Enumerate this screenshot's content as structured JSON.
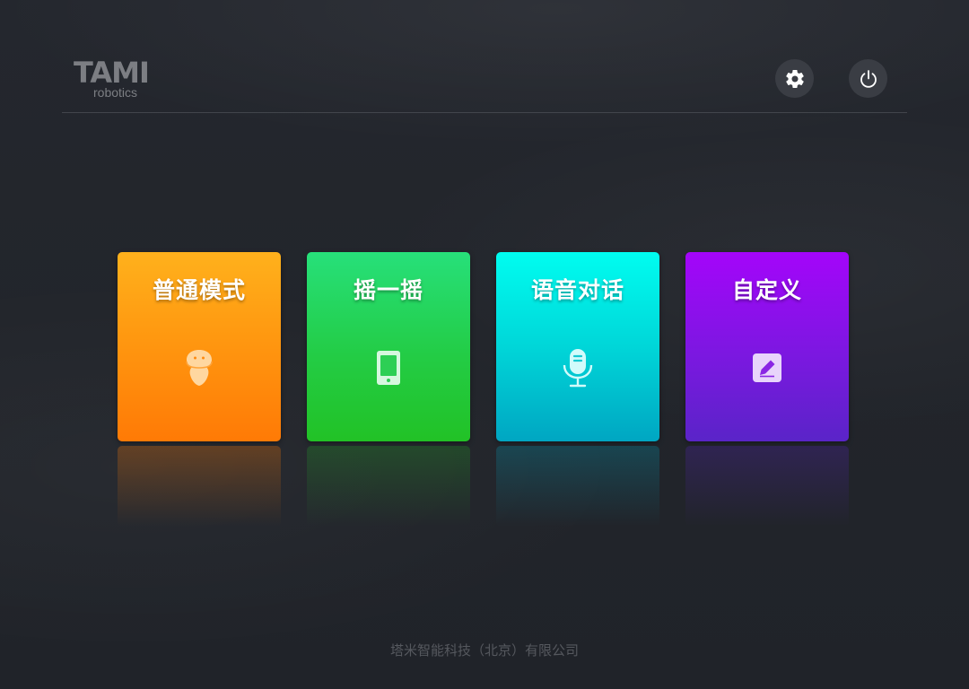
{
  "header": {
    "logo_text": "TAMI",
    "logo_sub": "robotics",
    "settings_icon": "gear-icon",
    "power_icon": "power-icon"
  },
  "modes": [
    {
      "label": "普通模式",
      "icon": "robot-icon",
      "color": "#ff9810"
    },
    {
      "label": "摇一摇",
      "icon": "phone-icon",
      "color": "#23cc45"
    },
    {
      "label": "语音对话",
      "icon": "microphone-icon",
      "color": "#00d6d8"
    },
    {
      "label": "自定义",
      "icon": "edit-icon",
      "color": "#7b18e0"
    }
  ],
  "footer": {
    "company": "塔米智能科技（北京）有限公司"
  },
  "colors": {
    "background": "#23262c",
    "button_bg": "#3a3d44",
    "divider": "#42454c"
  }
}
